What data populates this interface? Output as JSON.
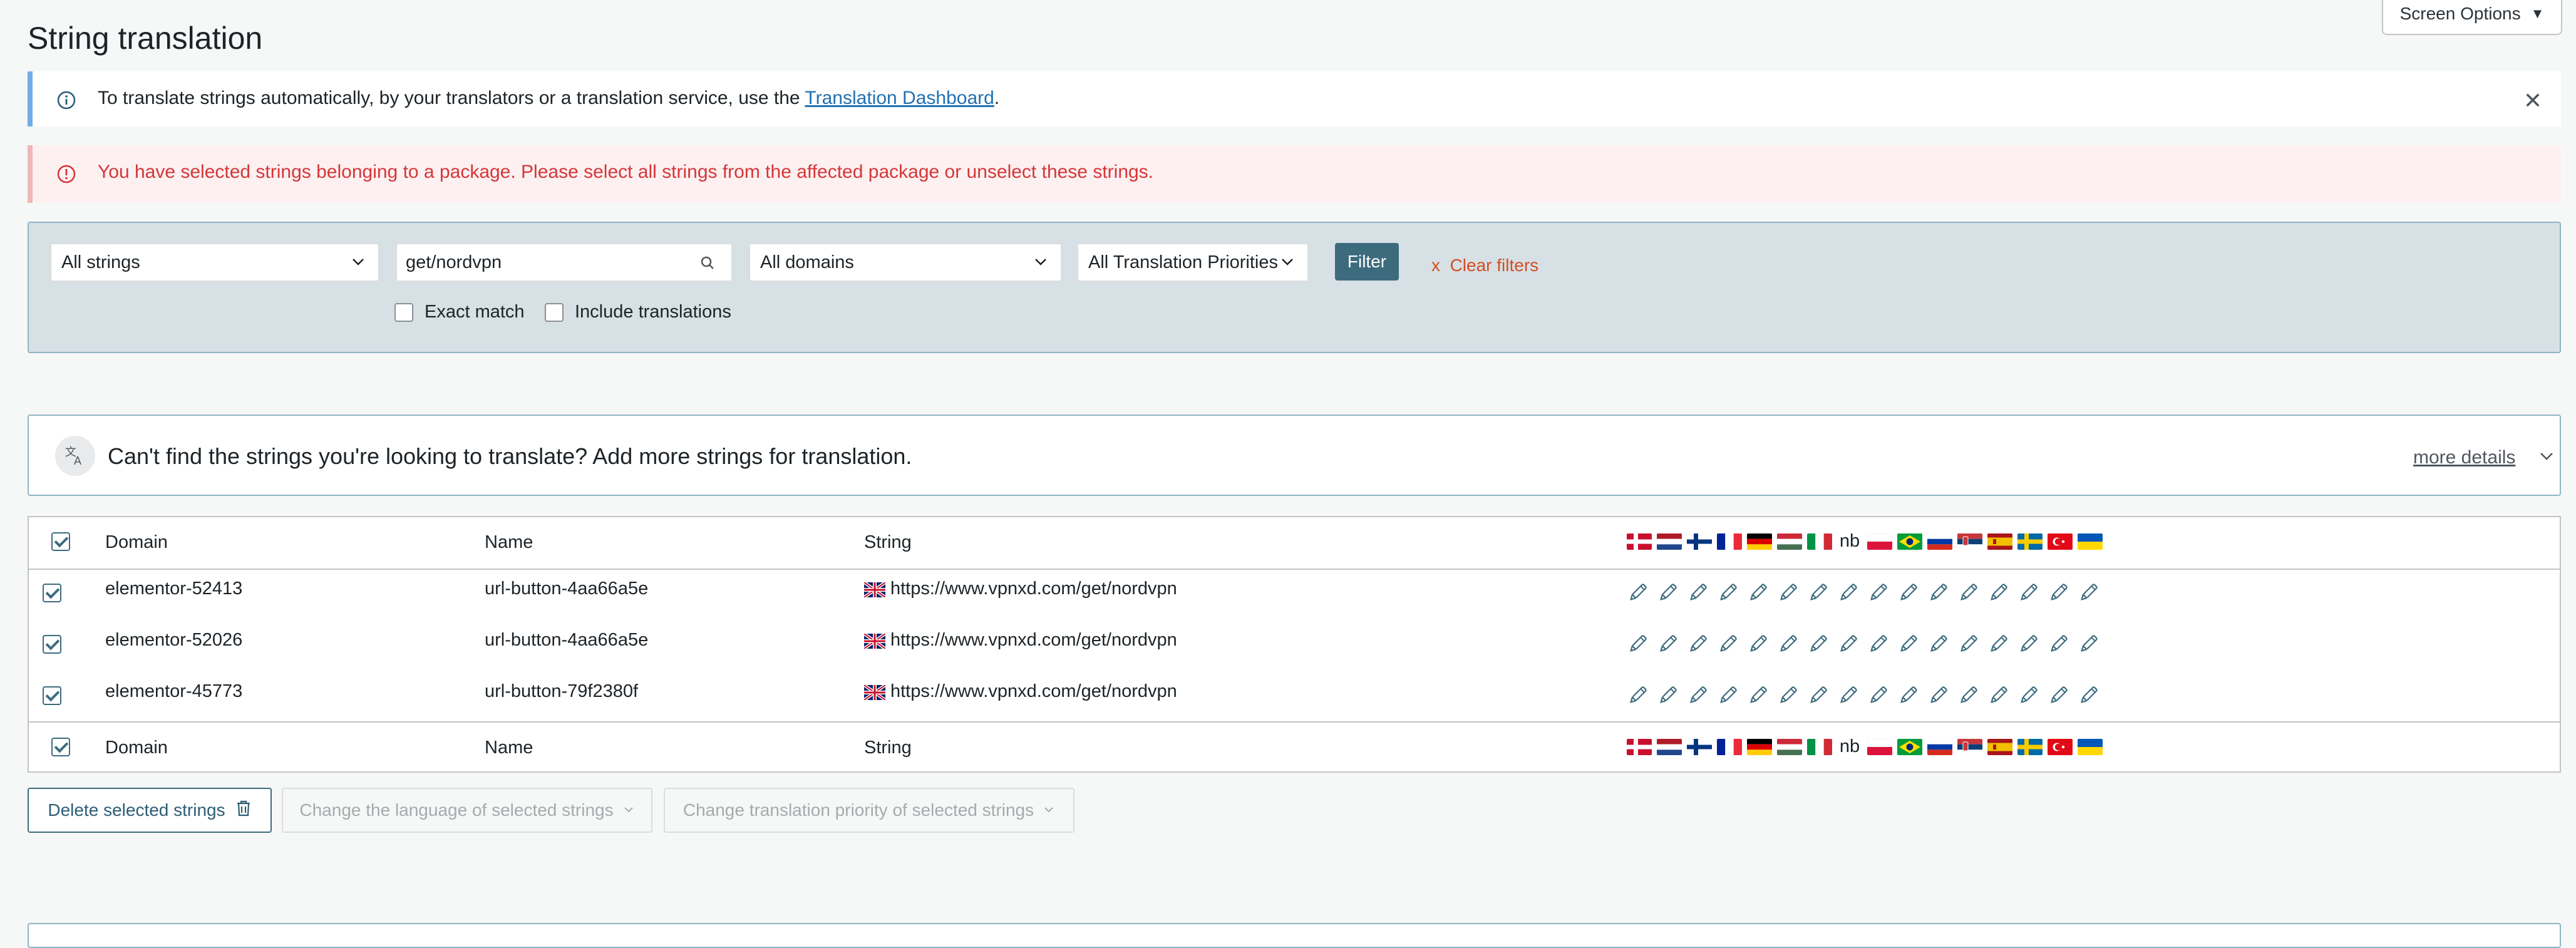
{
  "page": {
    "title": "String translation",
    "screen_options_label": "Screen Options"
  },
  "notice_info": {
    "text_before": "To translate strings automatically, by your translators or a translation service, use the",
    "link": "Translation Dashboard",
    "text_after": "."
  },
  "notice_error": {
    "text": "You have selected strings belonging to a package. Please select all strings from the affected package or unselect these strings."
  },
  "filters": {
    "strings_select": "All strings",
    "search_value": "get/nordvpn",
    "domains_select": "All domains",
    "priorities_select": "All Translation Priorities",
    "filter_button": "Filter",
    "clear_filters": "Clear filters",
    "clear_prefix": "x",
    "exact_match": "Exact match",
    "include_translations": "Include translations"
  },
  "add_strings": {
    "message": "Can't find the strings you're looking to translate? Add more strings for translation.",
    "more_details": "more details"
  },
  "table": {
    "headers": {
      "domain": "Domain",
      "name": "Name",
      "string": "String"
    },
    "lang_text_label": "nb",
    "languages": [
      "da",
      "nl",
      "fi",
      "fr",
      "de",
      "hu",
      "it",
      "nb",
      "pl",
      "pt-br",
      "ru",
      "sr",
      "es",
      "sv",
      "tr",
      "uk"
    ],
    "rows": [
      {
        "domain": "elementor-52413",
        "name": "url-button-4aa66a5e",
        "string": "https://www.vpnxd.com/get/nordvpn",
        "checked": true
      },
      {
        "domain": "elementor-52026",
        "name": "url-button-4aa66a5e",
        "string": "https://www.vpnxd.com/get/nordvpn",
        "checked": true
      },
      {
        "domain": "elementor-45773",
        "name": "url-button-79f2380f",
        "string": "https://www.vpnxd.com/get/nordvpn",
        "checked": true
      }
    ]
  },
  "bulk_actions": {
    "delete": "Delete selected strings",
    "change_language": "Change the language of selected strings",
    "change_priority": "Change translation priority of selected strings"
  },
  "colors": {
    "accent": "#3d6b7e",
    "error_text": "#d63638",
    "clear_filters": "#d54e21",
    "link": "#2271b1"
  }
}
